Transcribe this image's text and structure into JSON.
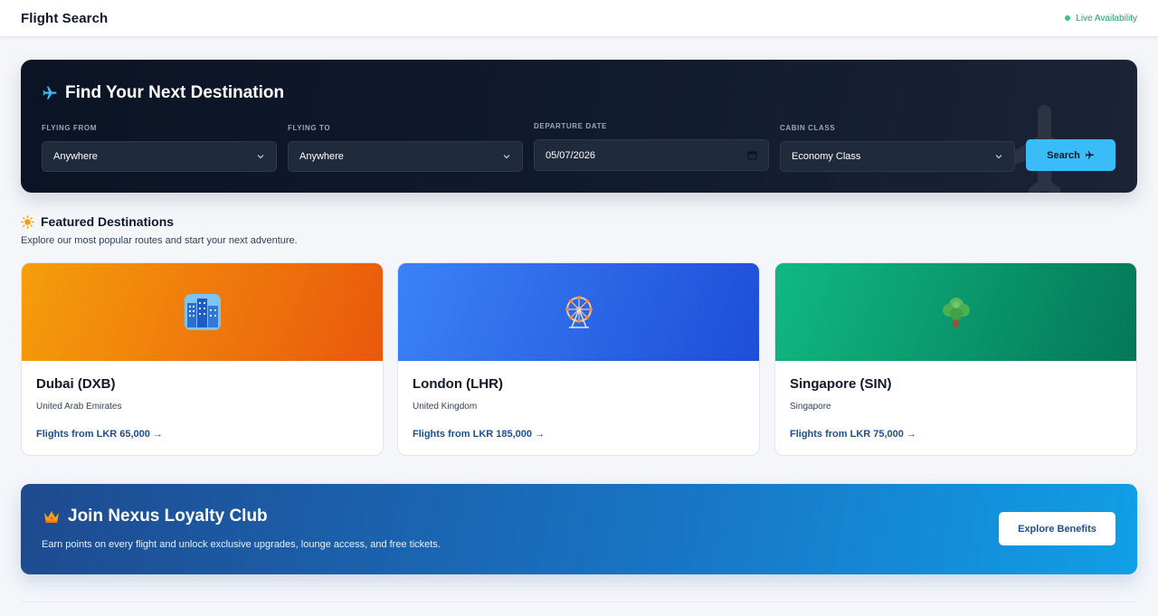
{
  "header": {
    "brand": "Flight Search",
    "live_status": "Live Availability"
  },
  "search": {
    "title": "Find Your Next Destination",
    "from_label": "FLYING FROM",
    "from_value": "Anywhere",
    "to_label": "FLYING TO",
    "to_value": "Anywhere",
    "date_label": "DEPARTURE DATE",
    "date_value": "05/07/2026",
    "class_label": "CABIN CLASS",
    "class_value": "Economy Class",
    "search_button": "Search"
  },
  "featured": {
    "title": "Featured Destinations",
    "subtitle": "Explore our most popular routes and start your next adventure.",
    "cards": [
      {
        "city": "Dubai (DXB)",
        "country": "United Arab Emirates",
        "price": "Flights from LKR 65,000 →",
        "icon": "city-buildings-icon",
        "gradient_from": "#f59e0b",
        "gradient_to": "#ea580c"
      },
      {
        "city": "London (LHR)",
        "country": "United Kingdom",
        "price": "Flights from LKR 185,000 →",
        "icon": "ferris-wheel-icon",
        "gradient_from": "#3b82f6",
        "gradient_to": "#1d4ed8"
      },
      {
        "city": "Singapore (SIN)",
        "country": "Singapore",
        "price": "Flights from LKR 75,000 →",
        "icon": "tree-icon",
        "gradient_from": "#10b981",
        "gradient_to": "#047857"
      }
    ]
  },
  "loyalty": {
    "title": "Join Nexus Loyalty Club",
    "subtitle": "Earn points on every flight and unlock exclusive upgrades, lounge access, and free tickets.",
    "button": "Explore Benefits"
  },
  "colors": {
    "accent": "#38bdf8",
    "live": "#22a06b",
    "link": "#1e4f93"
  }
}
